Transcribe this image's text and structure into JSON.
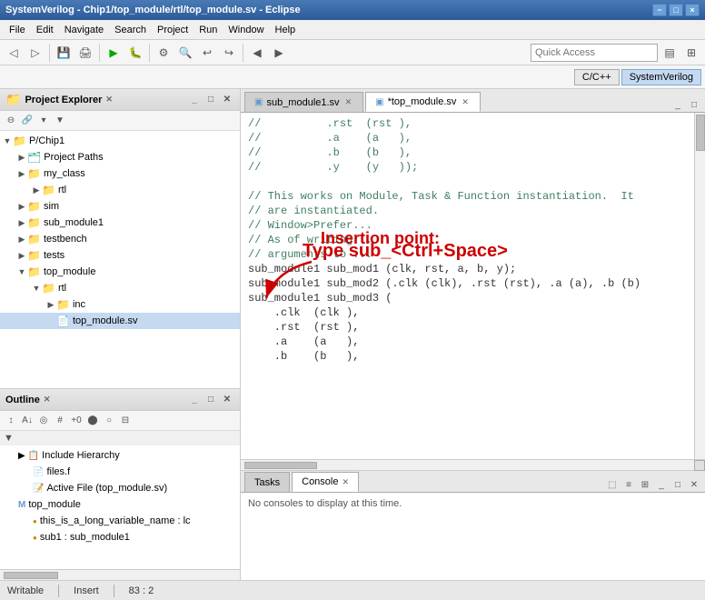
{
  "titleBar": {
    "title": "SystemVerilog - Chip1/top_module/rtl/top_module.sv - Eclipse",
    "controls": [
      "−",
      "□",
      "×"
    ]
  },
  "menuBar": {
    "items": [
      "File",
      "Edit",
      "Navigate",
      "Search",
      "Project",
      "Run",
      "Window",
      "Help"
    ]
  },
  "quickAccess": {
    "label": "Quick Access",
    "placeholder": "Quick Access"
  },
  "perspectives": {
    "items": [
      "C/C++",
      "SystemVerilog"
    ]
  },
  "projectExplorer": {
    "title": "Project Explorer",
    "tree": [
      {
        "label": "P/Chip1",
        "indent": 0,
        "type": "folder",
        "expanded": true
      },
      {
        "label": "Project Paths",
        "indent": 1,
        "type": "folder-special",
        "expanded": false
      },
      {
        "label": "my_class",
        "indent": 1,
        "type": "folder",
        "expanded": false
      },
      {
        "label": "rtl",
        "indent": 2,
        "type": "folder",
        "expanded": false
      },
      {
        "label": "sim",
        "indent": 1,
        "type": "folder",
        "expanded": false
      },
      {
        "label": "sub_module1",
        "indent": 1,
        "type": "folder",
        "expanded": false
      },
      {
        "label": "testbench",
        "indent": 1,
        "type": "folder",
        "expanded": false
      },
      {
        "label": "tests",
        "indent": 1,
        "type": "folder",
        "expanded": false
      },
      {
        "label": "top_module",
        "indent": 1,
        "type": "folder",
        "expanded": true
      },
      {
        "label": "rtl",
        "indent": 2,
        "type": "folder",
        "expanded": true
      },
      {
        "label": "inc",
        "indent": 3,
        "type": "folder",
        "expanded": false
      },
      {
        "label": "top_module.sv",
        "indent": 3,
        "type": "sv-file"
      }
    ]
  },
  "outline": {
    "title": "Outline",
    "items": [
      {
        "label": "Include Hierarchy",
        "indent": 1,
        "type": "hierarchy"
      },
      {
        "label": "files.f",
        "indent": 2,
        "type": "file"
      },
      {
        "label": "Active File (top_module.sv)",
        "indent": 2,
        "type": "active"
      },
      {
        "label": "top_module",
        "indent": 1,
        "type": "module"
      },
      {
        "label": "this_is_a_long_variable_name : lc",
        "indent": 2,
        "type": "var"
      },
      {
        "label": "sub1 : sub_module1",
        "indent": 2,
        "type": "var"
      }
    ]
  },
  "tabs": {
    "items": [
      {
        "label": "sub_module1.sv",
        "active": false,
        "modified": false
      },
      {
        "label": "*top_module.sv",
        "active": true,
        "modified": true
      }
    ]
  },
  "codeEditor": {
    "lines": [
      "//          .rst  (rst ),",
      "//          .a    (a   ),",
      "//          .b    (b   ),",
      "//          .y    (y   ));",
      "",
      "// This works on Module, Task & Function instantiation.  It",
      "// are instantiated.",
      "// Window>Prefer...",
      "// As of writing...",
      "// arguments to ..."
    ],
    "codeLines": [
      "sub_module1 sub_mod1 (clk, rst, a, b, y);",
      "sub_module1 sub_mod2 (.clk (clk), .rst (rst), .a (a), .b (b)",
      "sub_module1 sub_mod3 (",
      "    .clk  (clk ),",
      "    .rst  (rst ),",
      "    .a    (a   ),",
      "    .b    (b   ),"
    ],
    "annotation": {
      "insertionPoint": "Insertion point:",
      "ctrlSpace": "Type sub_<Ctrl+Space>"
    }
  },
  "consoleTabs": {
    "items": [
      "Tasks",
      "Console"
    ]
  },
  "consoleContent": "No consoles to display at this time.",
  "statusBar": {
    "writable": "Writable",
    "mode": "Insert",
    "position": "83 : 2"
  }
}
